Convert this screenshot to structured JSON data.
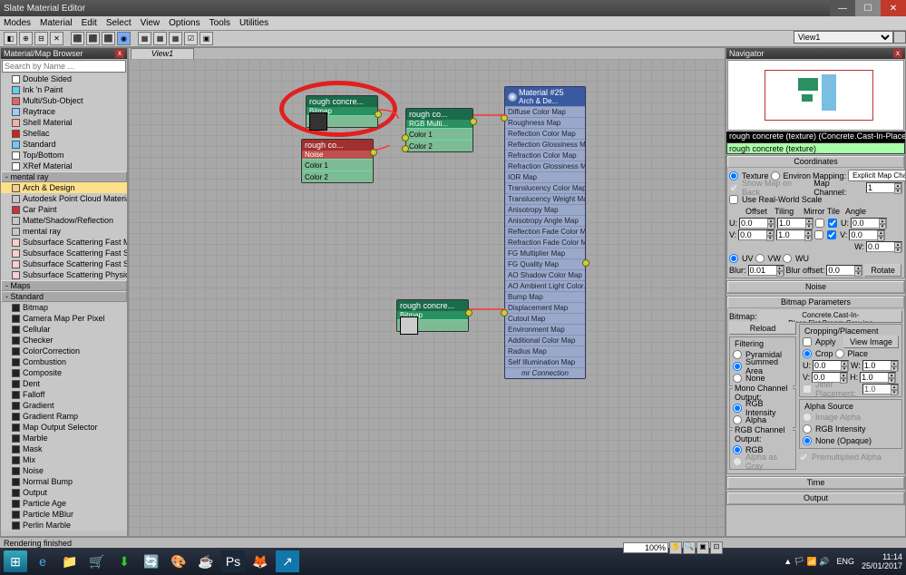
{
  "window": {
    "title": "Slate Material Editor"
  },
  "menubar": [
    "Modes",
    "Material",
    "Edit",
    "Select",
    "View",
    "Options",
    "Tools",
    "Utilities"
  ],
  "browser": {
    "title": "Material/Map Browser",
    "search_placeholder": "Search by Name ...",
    "materials_section1": [
      "Double Sided",
      "Ink 'n Paint",
      "Multi/Sub-Object",
      "Raytrace",
      "Shell Material",
      "Shellac",
      "Standard",
      "Top/Bottom",
      "XRef Material"
    ],
    "mentalray_header": "- mental ray",
    "mentalray": [
      "Arch & Design",
      "Autodesk Point Cloud Material",
      "Car Paint",
      "Matte/Shadow/Reflection",
      "mental ray",
      "Subsurface Scattering Fast Mat...",
      "Subsurface Scattering Fast Skin",
      "Subsurface Scattering Fast Skin...",
      "Subsurface Scattering Physical"
    ],
    "maps_header": "- Maps",
    "standard_header": "- Standard",
    "maps": [
      "Bitmap",
      "Camera Map Per Pixel",
      "Cellular",
      "Checker",
      "ColorCorrection",
      "Combustion",
      "Composite",
      "Dent",
      "Falloff",
      "Gradient",
      "Gradient Ramp",
      "Map Output Selector",
      "Marble",
      "Mask",
      "Mix",
      "Noise",
      "Normal Bump",
      "Output",
      "Particle Age",
      "Particle MBlur",
      "Perlin Marble"
    ]
  },
  "view_tab": "View1",
  "views_dropdown": "View1",
  "nodes": {
    "bitmap1": {
      "title": "rough concre...",
      "sub": "Bitmap"
    },
    "noise": {
      "title": "rough co...",
      "sub": "Noise",
      "rows": [
        "Color 1",
        "Color 2"
      ]
    },
    "rgbmult": {
      "title": "rough co...",
      "sub": "RGB Multi...",
      "rows": [
        "Color 1",
        "Color 2"
      ]
    },
    "bitmap2": {
      "title": "rough concre...",
      "sub": "Bitmap"
    },
    "material": {
      "title": "Material #25",
      "sub": "Arch & De...",
      "slots": [
        "Diffuse Color Map",
        "Roughness Map",
        "Reflection Color Map",
        "Reflection Glossiness Map",
        "Refraction Color Map",
        "Refraction Glossiness Map",
        "IOR Map",
        "Translucency Color Map",
        "Translucency Weight Map",
        "Anisotropy Map",
        "Anisotropy Angle Map",
        "Reflection Fade Color Map",
        "Refraction Fade Color Map",
        "FG Multiplier Map",
        "FG Quality Map",
        "AO Shadow Color Map",
        "AO Ambient Light Color...",
        "Bump Map",
        "Displacement Map",
        "Cutout Map",
        "Environment Map",
        "Additional Color Map",
        "Radius Map",
        "Self Illumination Map"
      ],
      "footer": "mr Connection"
    }
  },
  "navigator": {
    "title": "Navigator"
  },
  "strip_title": "rough concrete (texture) (Concrete.Cast-In-Place.Fla...",
  "strip_value": "rough concrete (texture)",
  "coords": {
    "header": "Coordinates",
    "texture": "Texture",
    "environ": "Environ",
    "mapping_label": "Mapping:",
    "mapping_value": "Explicit Map Channel",
    "show_map": "Show Map on Back",
    "map_channel": "Map Channel:",
    "map_channel_value": "1",
    "real_world": "Use Real-World Scale",
    "offset": "Offset",
    "tiling": "Tiling",
    "mirror_tile": "Mirror Tile",
    "angle": "Angle",
    "u": "U:",
    "v": "V:",
    "w": "W:",
    "u_off": "0.0",
    "v_off": "0.0",
    "u_tile": "1.0",
    "v_tile": "1.0",
    "u_ang": "0.0",
    "v_ang": "0.0",
    "w_ang": "0.0",
    "uv": "UV",
    "vw": "VW",
    "wu": "WU",
    "blur": "Blur:",
    "blur_val": "0.01",
    "blur_off": "Blur offset:",
    "blur_off_val": "0.0",
    "rotate": "Rotate"
  },
  "rollouts": {
    "noise": "Noise",
    "bitmap_params": "Bitmap Parameters",
    "time": "Time",
    "output": "Output"
  },
  "bitmap_params": {
    "bitmap_label": "Bitmap:",
    "bitmap_value": "Concrete.Cast-In-Place.Flat.Broom.Grey.jpg",
    "reload": "Reload",
    "cropping": "Cropping/Placement",
    "apply": "Apply",
    "view_image": "View Image",
    "crop": "Crop",
    "place": "Place",
    "filtering": "Filtering",
    "pyramidal": "Pyramidal",
    "summed": "Summed Area",
    "none": "None",
    "mono": "Mono Channel Output:",
    "rgb_int": "RGB Intensity",
    "alpha": "Alpha",
    "rgbch": "RGB Channel Output:",
    "rgb": "RGB",
    "alpha_gray": "Alpha as Gray",
    "alpha_src": "Alpha Source",
    "img_alpha": "Image Alpha",
    "rgb_int2": "RGB Intensity",
    "none_opaque": "None (Opaque)",
    "premult": "Premultiplied Alpha",
    "jitter": "Jitter Placement:",
    "jitter_val": "1.0",
    "u": "U:",
    "v": "V:",
    "w_lbl": "W:",
    "h_lbl": "H:",
    "uval": "0.0",
    "vval": "0.0",
    "wval": "1.0",
    "hval": "1.0"
  },
  "zoom": "100%",
  "status": "Rendering finished",
  "taskbar": {
    "icons": [
      "⊞",
      "e",
      "📁",
      "🛒",
      "⬇",
      "🔄",
      "🎨",
      "☕",
      "Ps",
      "🦊",
      "↗"
    ],
    "lang": "ENG",
    "time": "11:14",
    "date": "25/01/2017"
  }
}
